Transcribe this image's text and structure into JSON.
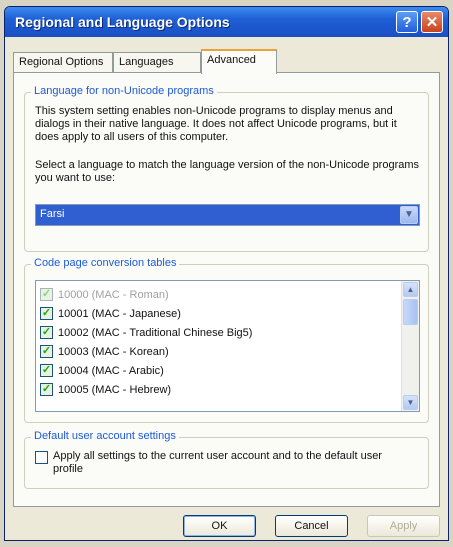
{
  "window": {
    "title": "Regional and Language Options",
    "help_label": "?",
    "close_label": "✕"
  },
  "tabs": [
    {
      "label": "Regional Options",
      "active": false
    },
    {
      "label": "Languages",
      "active": false
    },
    {
      "label": "Advanced",
      "active": true
    }
  ],
  "non_unicode": {
    "legend": "Language for non-Unicode programs",
    "description": "This system setting enables non-Unicode programs to display menus and dialogs in their native language. It does not affect Unicode programs, but it does apply to all users of this computer.",
    "select_prompt": "Select a language to match the language version of the non-Unicode programs you want to use:",
    "selected_language": "Farsi"
  },
  "code_pages": {
    "legend": "Code page conversion tables",
    "items": [
      {
        "label": "10000 (MAC - Roman)",
        "checked": true
      },
      {
        "label": "10001 (MAC - Japanese)",
        "checked": true
      },
      {
        "label": "10002 (MAC - Traditional Chinese Big5)",
        "checked": true
      },
      {
        "label": "10003 (MAC - Korean)",
        "checked": true
      },
      {
        "label": "10004 (MAC - Arabic)",
        "checked": true
      },
      {
        "label": "10005 (MAC - Hebrew)",
        "checked": true
      }
    ]
  },
  "default_user": {
    "legend": "Default user account settings",
    "apply_label": "Apply all settings to the current user account and to the default user profile",
    "checked": false
  },
  "buttons": {
    "ok": "OK",
    "cancel": "Cancel",
    "apply": "Apply"
  },
  "colors": {
    "titlebar": "#1e5fd6",
    "legend_text": "#1c5bd6",
    "selection": "#2f5fd0",
    "dialog_bg": "#ece9d8"
  }
}
